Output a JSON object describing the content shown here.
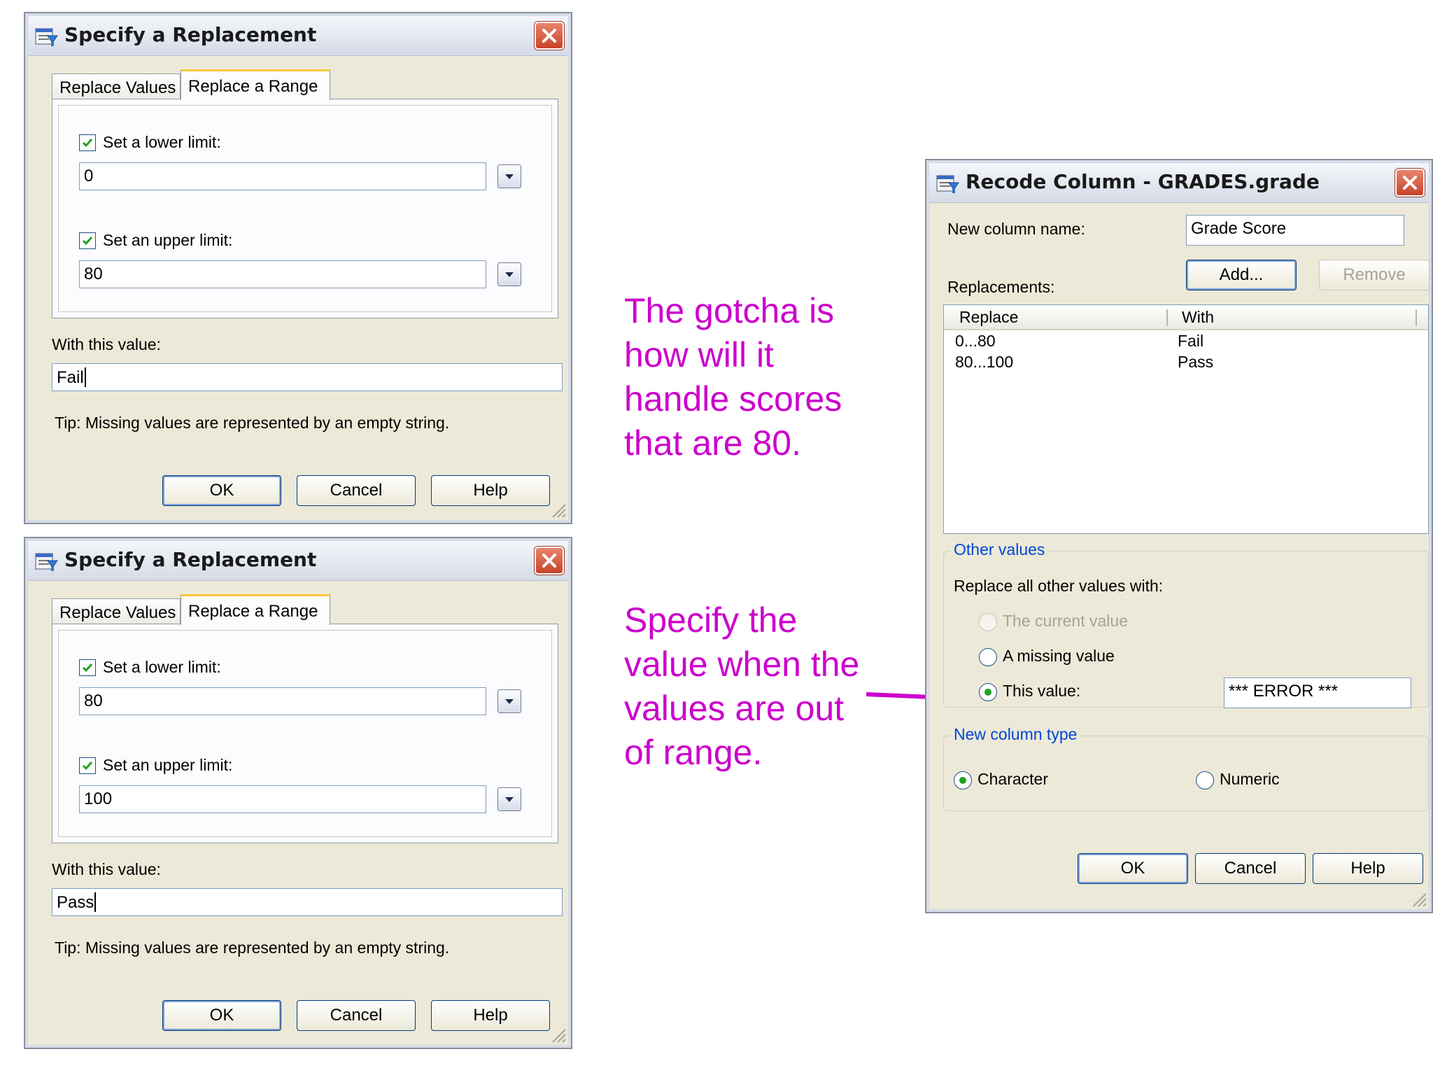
{
  "dialog1": {
    "title": "Specify a Replacement",
    "tabs": [
      "Replace Values",
      "Replace a Range"
    ],
    "lower_label": "Set a lower limit:",
    "lower_value": "0",
    "upper_label": "Set an upper limit:",
    "upper_value": "80",
    "with_label": "With this value:",
    "with_value": "Fail",
    "tip": "Tip: Missing values are represented by an empty string.",
    "buttons": {
      "ok": "OK",
      "cancel": "Cancel",
      "help": "Help"
    }
  },
  "dialog2": {
    "title": "Specify a Replacement",
    "tabs": [
      "Replace Values",
      "Replace a Range"
    ],
    "lower_label": "Set a lower limit:",
    "lower_value": "80",
    "upper_label": "Set an upper limit:",
    "upper_value": "100",
    "with_label": "With this value:",
    "with_value": "Pass",
    "tip": "Tip: Missing values are represented by an empty string.",
    "buttons": {
      "ok": "OK",
      "cancel": "Cancel",
      "help": "Help"
    }
  },
  "recode": {
    "title": "Recode Column - GRADES.grade",
    "new_column_label": "New column name:",
    "new_column_value": "Grade Score",
    "add_button": "Add...",
    "remove_button": "Remove",
    "replacements_label": "Replacements:",
    "columns": [
      "Replace",
      "With"
    ],
    "rows": [
      {
        "replace": "0...80",
        "with": "Fail"
      },
      {
        "replace": "80...100",
        "with": "Pass"
      }
    ],
    "other_values": {
      "title": "Other values",
      "prompt": "Replace all other values with:",
      "opt_current": "The current value",
      "opt_missing": "A missing value",
      "opt_this": "This value:",
      "this_value": "*** ERROR ***"
    },
    "column_type": {
      "title": "New column type",
      "character": "Character",
      "numeric": "Numeric"
    },
    "buttons": {
      "ok": "OK",
      "cancel": "Cancel",
      "help": "Help"
    }
  },
  "annotations": {
    "gotcha": [
      "The gotcha is",
      "how will it",
      "handle scores",
      "that are 80."
    ],
    "specify": [
      "Specify the",
      "value when the",
      "values are out",
      "of range."
    ]
  },
  "colors": {
    "annotation": "#cc00cc",
    "arrow": "#cc00cc",
    "radio_dot": "#21a121"
  }
}
